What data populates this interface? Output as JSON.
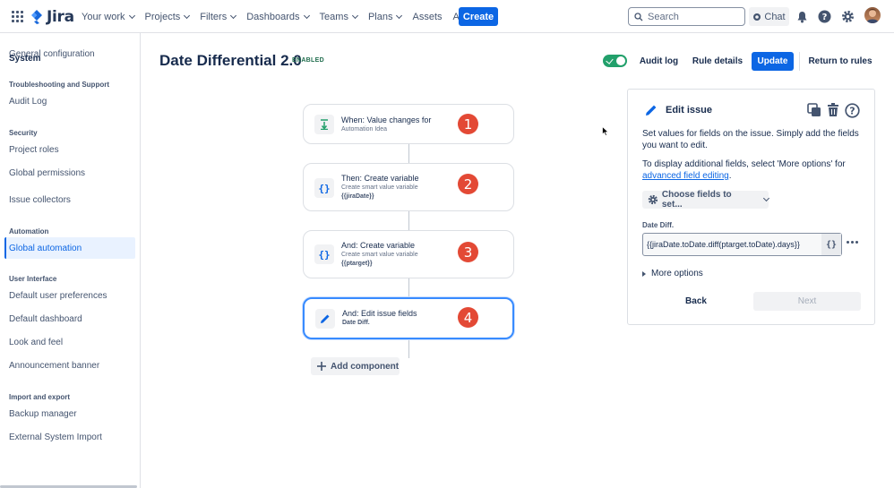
{
  "topnav": {
    "logo_text": "Jira",
    "items": [
      {
        "label": "Your work",
        "dropdown": true
      },
      {
        "label": "Projects",
        "dropdown": true
      },
      {
        "label": "Filters",
        "dropdown": true
      },
      {
        "label": "Dashboards",
        "dropdown": true
      },
      {
        "label": "Teams",
        "dropdown": true
      },
      {
        "label": "Plans",
        "dropdown": true
      },
      {
        "label": "Assets",
        "dropdown": false
      },
      {
        "label": "Apps",
        "dropdown": true
      }
    ],
    "create_label": "Create",
    "search_placeholder": "Search",
    "chat_label": "Chat"
  },
  "sidebar": {
    "title": "System",
    "items": [
      {
        "label": "General configuration",
        "type": "item"
      },
      {
        "label": "Troubleshooting and Support",
        "type": "head"
      },
      {
        "label": "Audit Log",
        "type": "item"
      },
      {
        "label": "Security",
        "type": "head"
      },
      {
        "label": "Project roles",
        "type": "item"
      },
      {
        "label": "Global permissions",
        "type": "item"
      },
      {
        "label": "Issue collectors",
        "type": "item"
      },
      {
        "label": "Automation",
        "type": "head"
      },
      {
        "label": "Global automation",
        "type": "item",
        "active": true
      },
      {
        "label": "User Interface",
        "type": "head"
      },
      {
        "label": "Default user preferences",
        "type": "item"
      },
      {
        "label": "Default dashboard",
        "type": "item"
      },
      {
        "label": "Look and feel",
        "type": "item"
      },
      {
        "label": "Announcement banner",
        "type": "item"
      },
      {
        "label": "Import and export",
        "type": "head"
      },
      {
        "label": "Backup manager",
        "type": "item"
      },
      {
        "label": "External System Import",
        "type": "item"
      }
    ]
  },
  "header": {
    "title": "Date Differential 2.0",
    "status": "ENABLED",
    "audit_log": "Audit log",
    "rule_details": "Rule details",
    "update": "Update",
    "return": "Return to rules"
  },
  "flow": {
    "cards": [
      {
        "title": "When: Value changes for",
        "sub": "Automation Idea",
        "sub2": "",
        "icon": "trigger-icon",
        "number": "1"
      },
      {
        "title": "Then: Create variable",
        "sub": "Create smart value variable",
        "sub2": "{{jiraDate}}",
        "icon": "smart-value-icon",
        "number": "2"
      },
      {
        "title": "And: Create variable",
        "sub": "Create smart value variable",
        "sub2": "{{ptarget}}",
        "icon": "smart-value-icon",
        "number": "3"
      },
      {
        "title": "And: Edit issue fields",
        "sub": "",
        "sub2": "Date Diff.",
        "icon": "pencil-icon",
        "number": "4"
      }
    ],
    "add_component": "Add component"
  },
  "panel": {
    "title": "Edit issue",
    "desc1": "Set values for fields on the issue. Simply add the fields you want to edit.",
    "desc2_prefix": "To display additional fields, select 'More options' for",
    "desc2_link": "advanced field editing",
    "desc2_suffix": ".",
    "choose_fields": "Choose fields to set...",
    "field_label": "Date Diff.",
    "field_value": "{{jiraDate.toDate.diff(ptarget.toDate).days}}",
    "smart_glyph": "{}",
    "more_options": "More options",
    "back": "Back",
    "next": "Next"
  },
  "colors": {
    "primary": "#0c66e4",
    "badge": "#e34935",
    "enabled": "#22a06b"
  }
}
